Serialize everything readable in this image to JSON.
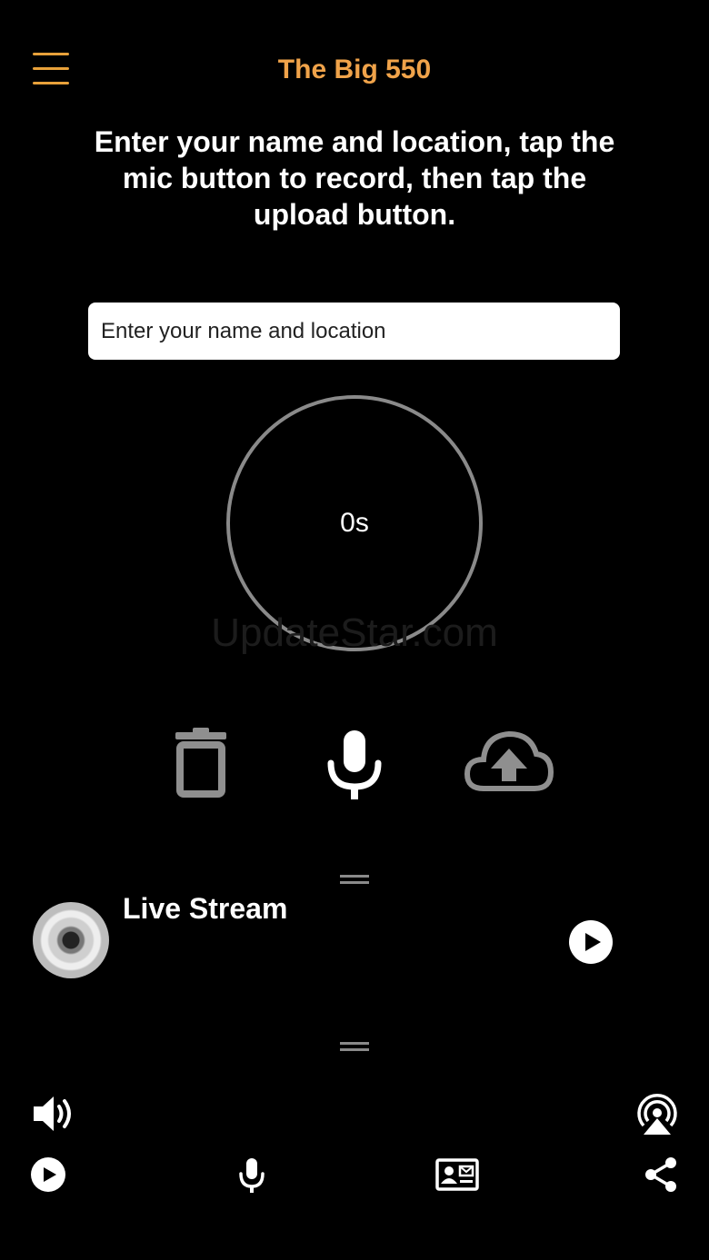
{
  "header": {
    "title": "The Big 550",
    "menu_icon": "hamburger-menu-icon"
  },
  "instructions": "Enter your name and location, tap the mic button to record, then tap the upload button.",
  "name_input": {
    "placeholder": "Enter your name and location",
    "value": ""
  },
  "timer": {
    "elapsed": "0s"
  },
  "watermark": "UpdateStar.com",
  "record_controls": {
    "delete_icon": "trash-icon",
    "record_icon": "microphone-icon",
    "upload_icon": "cloud-upload-icon"
  },
  "stream": {
    "title": "Live Stream",
    "artwork_icon": "cd-disc-icon",
    "play_icon": "play-icon"
  },
  "bottom_bar": {
    "volume_icon": "volume-icon",
    "airplay_icon": "airplay-icon",
    "play_icon": "play-icon",
    "mic_icon": "microphone-icon",
    "contact_icon": "contact-card-icon",
    "share_icon": "share-icon"
  },
  "colors": {
    "background": "#000000",
    "accent": "#f0a34a",
    "ring": "#8a8a8a",
    "inactive_icon": "#8f8f8f"
  }
}
